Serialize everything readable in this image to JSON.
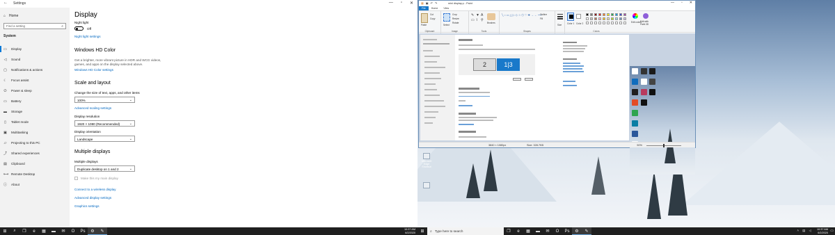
{
  "settings": {
    "window_title": "Settings",
    "home": "Home",
    "search_placeholder": "Find a setting",
    "section": "System",
    "nav_items": [
      {
        "label": "Display",
        "icon": "monitor-icon"
      },
      {
        "label": "Sound",
        "icon": "speaker-icon"
      },
      {
        "label": "Notifications & actions",
        "icon": "notification-icon"
      },
      {
        "label": "Focus assist",
        "icon": "moon-icon"
      },
      {
        "label": "Power & sleep",
        "icon": "power-icon"
      },
      {
        "label": "Battery",
        "icon": "battery-icon"
      },
      {
        "label": "Storage",
        "icon": "storage-icon"
      },
      {
        "label": "Tablet mode",
        "icon": "tablet-icon"
      },
      {
        "label": "Multitasking",
        "icon": "multitask-icon"
      },
      {
        "label": "Projecting to this PC",
        "icon": "project-icon"
      },
      {
        "label": "Shared experiences",
        "icon": "share-icon"
      },
      {
        "label": "Clipboard",
        "icon": "clipboard-icon"
      },
      {
        "label": "Remote Desktop",
        "icon": "remote-icon"
      },
      {
        "label": "About",
        "icon": "info-icon"
      }
    ],
    "page_title": "Display",
    "night_light_label": "Night light",
    "night_light_state": "Off",
    "night_light_settings_link": "Night light settings",
    "hdr_heading": "Windows HD Color",
    "hdr_desc": "Get a brighter, more vibrant picture in HDR and WCG videos, games, and apps on the display selected above.",
    "hdr_link": "Windows HD Color settings",
    "scale_heading": "Scale and layout",
    "scale_label": "Change the size of text, apps, and other items",
    "scale_value": "100%",
    "adv_scaling_link": "Advanced scaling settings",
    "resolution_label": "Display resolution",
    "resolution_value": "1920 × 1080 (Recommended)",
    "orientation_label": "Display orientation",
    "orientation_value": "Landscape",
    "multi_heading": "Multiple displays",
    "multi_label": "Multiple displays",
    "multi_value": "Duplicate desktop on 1 and 2",
    "main_display_label": "Make this my main display",
    "wireless_link": "Connect to a wireless display",
    "adv_display_link": "Advanced display settings",
    "graphics_link": "Graphics settings"
  },
  "taskbar_left": {
    "icons": [
      "windows-icon",
      "search-icon",
      "task-view-icon",
      "edge-icon",
      "store-icon",
      "folder-icon",
      "mail-icon",
      "outlook-icon",
      "photoshop-icon",
      "settings-icon",
      "paint-icon"
    ],
    "time": "10:37 AM",
    "date": "6/2/2020"
  },
  "taskbar_right": {
    "search_placeholder": "Type here to search",
    "icons": [
      "task-view-icon",
      "edge-icon",
      "store-icon",
      "folder-icon",
      "mail-icon",
      "outlook-icon",
      "photoshop-icon",
      "settings-icon",
      "paint-icon"
    ],
    "time": "10:37 AM",
    "date": "6/2/2020"
  },
  "paint": {
    "title": "mini display.p - Paint",
    "tabs": [
      "File",
      "Home",
      "View"
    ],
    "groups": [
      "Clipboard",
      "Image",
      "Tools",
      "Shapes",
      "Colors"
    ],
    "clipboard_items": [
      "Paste",
      "Cut",
      "Copy"
    ],
    "image_items": [
      "Select",
      "Crop",
      "Resize",
      "Rotate"
    ],
    "tools_label": "Brushes",
    "shape_items": [
      "Outline",
      "Fill"
    ],
    "size_label": "Size",
    "color1_label": "Color 1",
    "color2_label": "Color 2",
    "edit_colors_label": "Edit colors",
    "paint3d_label": "Edit with Paint 3D",
    "palette": [
      "#000000",
      "#7f7f7f",
      "#880015",
      "#ed1c24",
      "#ff7f27",
      "#fff200",
      "#22b14c",
      "#00a2e8",
      "#3f48cc",
      "#a349a4",
      "#ffffff",
      "#c3c3c3",
      "#b97a57",
      "#ffaec9",
      "#ffc90e",
      "#efe4b0",
      "#b5e61d",
      "#99d9ea",
      "#7092be",
      "#c8bfe7"
    ],
    "status_dimensions": "3840 × 1080px",
    "status_size": "Size: 328.7KB",
    "zoom": "50%",
    "zoom_fraction": 0.5,
    "canvas_monitor_1": "2",
    "canvas_monitor_2": "1|3"
  },
  "desktop_icon_label": "Microsoft Edge Shortcut"
}
